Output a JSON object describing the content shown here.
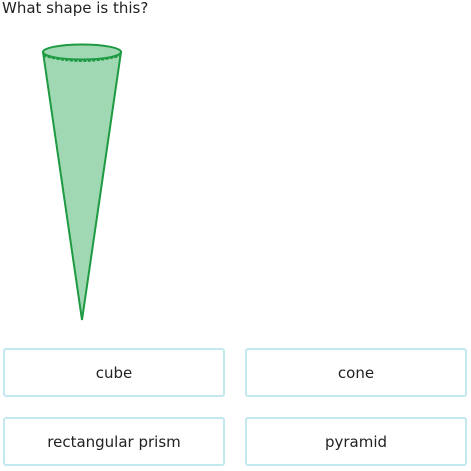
{
  "question": {
    "text": "What shape is this?"
  },
  "figure": {
    "shape": "cone",
    "fill_color": "#9fd8b3",
    "stroke_color": "#1e9a42"
  },
  "answers": [
    {
      "label": "cube"
    },
    {
      "label": "cone"
    },
    {
      "label": "rectangular prism"
    },
    {
      "label": "pyramid"
    }
  ],
  "colors": {
    "answer_border": "#c4e8ef",
    "text": "#222222"
  }
}
